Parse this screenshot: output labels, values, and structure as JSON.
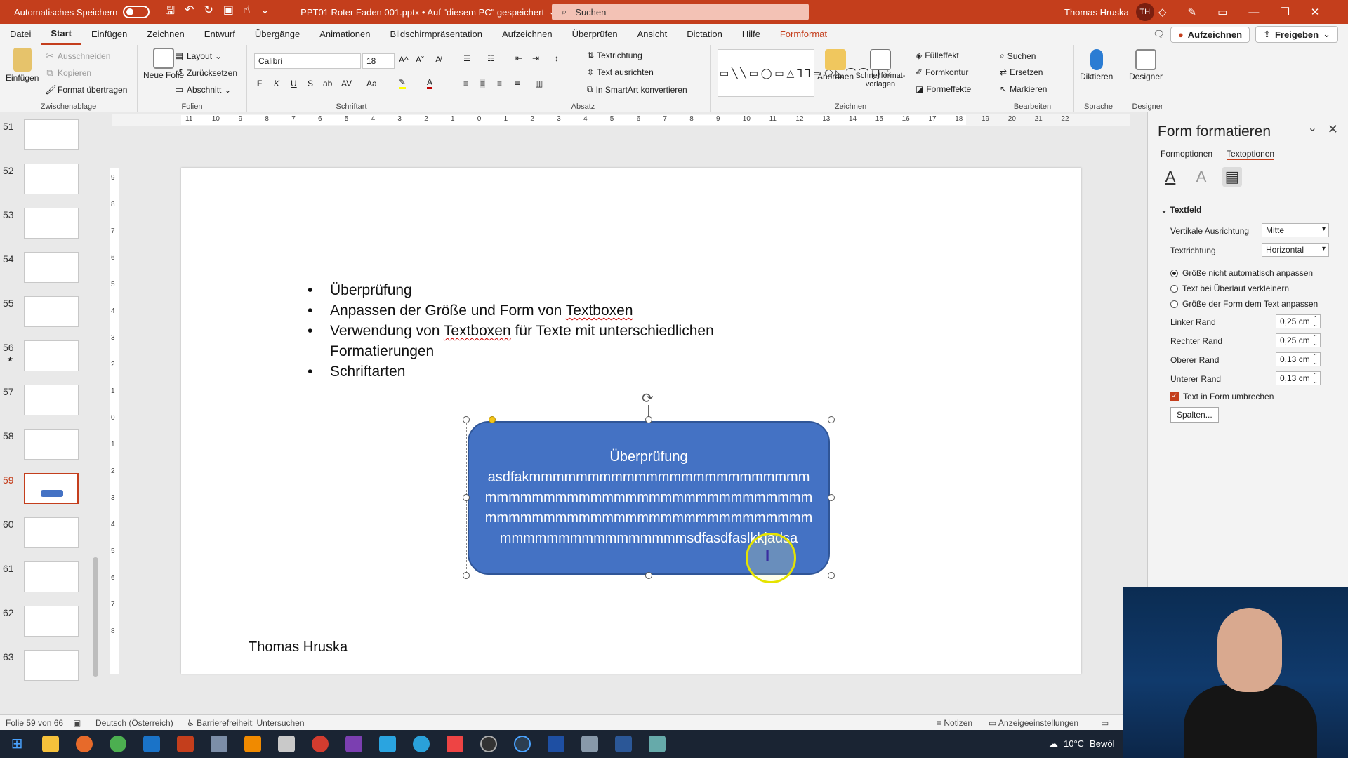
{
  "titlebar": {
    "autosave_label": "Automatisches Speichern",
    "doc_title": "PPT01 Roter Faden 001.pptx • Auf \"diesem PC\" gespeichert",
    "search_placeholder": "Suchen",
    "user_name": "Thomas Hruska",
    "user_initials": "TH"
  },
  "menu": {
    "tabs": [
      "Datei",
      "Start",
      "Einfügen",
      "Zeichnen",
      "Entwurf",
      "Übergänge",
      "Animationen",
      "Bildschirmpräsentation",
      "Aufzeichnen",
      "Überprüfen",
      "Ansicht",
      "Dictation",
      "Hilfe",
      "Formformat"
    ],
    "active_tab": "Start",
    "record_label": "Aufzeichnen",
    "share_label": "Freigeben"
  },
  "ribbon": {
    "clipboard": {
      "paste": "Einfügen",
      "cut": "Ausschneiden",
      "copy": "Kopieren",
      "format_painter": "Format übertragen",
      "label": "Zwischenablage"
    },
    "slides": {
      "new_slide": "Neue Folie",
      "layout": "Layout",
      "reset": "Zurücksetzen",
      "section": "Abschnitt",
      "label": "Folien"
    },
    "font": {
      "family": "Calibri",
      "size": "18",
      "bold": "F",
      "italic": "K",
      "underline": "U",
      "shadow": "S",
      "strike": "ab",
      "spacing": "AV",
      "case": "Aa",
      "label": "Schriftart"
    },
    "paragraph": {
      "text_direction": "Textrichtung",
      "align_text": "Text ausrichten",
      "smartart": "In SmartArt konvertieren",
      "label": "Absatz"
    },
    "drawing": {
      "arrange": "Anordnen",
      "quick_styles": "Schnellformat-vorlagen",
      "fill": "Fülleffekt",
      "outline": "Formkontur",
      "effects": "Formeffekte",
      "label": "Zeichnen"
    },
    "editing": {
      "find": "Suchen",
      "replace": "Ersetzen",
      "select": "Markieren",
      "label": "Bearbeiten"
    },
    "voice": {
      "dictate": "Diktieren",
      "label": "Sprache"
    },
    "designer": {
      "designer": "Designer",
      "label": "Designer"
    }
  },
  "thumbnails": [
    {
      "num": "51"
    },
    {
      "num": "52"
    },
    {
      "num": "53"
    },
    {
      "num": "54"
    },
    {
      "num": "55"
    },
    {
      "num": "56"
    },
    {
      "num": "57"
    },
    {
      "num": "58"
    },
    {
      "num": "59"
    },
    {
      "num": "60"
    },
    {
      "num": "61"
    },
    {
      "num": "62"
    },
    {
      "num": "63"
    }
  ],
  "active_slide": "59",
  "ruler": {
    "h_ticks": [
      "11",
      "10",
      "9",
      "8",
      "7",
      "6",
      "5",
      "4",
      "3",
      "2",
      "1",
      "0",
      "1",
      "2",
      "3",
      "4",
      "5",
      "6",
      "7",
      "8",
      "9",
      "10",
      "11",
      "12",
      "13",
      "14",
      "15",
      "16",
      "17",
      "18",
      "19",
      "20",
      "21",
      "22"
    ],
    "v_ticks": [
      "9",
      "8",
      "7",
      "6",
      "5",
      "4",
      "3",
      "2",
      "1",
      "0",
      "1",
      "2",
      "3",
      "4",
      "5",
      "6",
      "7",
      "8"
    ]
  },
  "slide": {
    "bullets": [
      "Überprüfung",
      "Anpassen der Größe und Form von Textboxen",
      "Verwendung von Textboxen für Texte mit unterschiedlichen Formatierungen",
      "Schriftarten"
    ],
    "shape_title": "Überprüfung",
    "shape_body": "asdfakmmmmmmmmmmmmmmmmmmmmmmmmmmmmmmmmmmmmmmmmmmmmmmmmmmmmmmmmmmmmmmmmmmmmmmmmmmmmmmmmmmmmmmmmmmmmmmmmsdfasdfaslkkjadsa",
    "footer_name": "Thomas Hruska"
  },
  "pane": {
    "title": "Form formatieren",
    "tabs": [
      "Formoptionen",
      "Textoptionen"
    ],
    "section": "Textfeld",
    "vertical_align_label": "Vertikale Ausrichtung",
    "vertical_align_value": "Mitte",
    "text_direction_label": "Textrichtung",
    "text_direction_value": "Horizontal",
    "radio_no_autofit": "Größe nicht automatisch anpassen",
    "radio_shrink": "Text bei Überlauf verkleinern",
    "radio_resize": "Größe der Form dem Text anpassen",
    "left_margin_label": "Linker Rand",
    "left_margin": "0,25 cm",
    "right_margin_label": "Rechter Rand",
    "right_margin": "0,25 cm",
    "top_margin_label": "Oberer Rand",
    "top_margin": "0,13 cm",
    "bottom_margin_label": "Unterer Rand",
    "bottom_margin": "0,13 cm",
    "wrap_label": "Text in Form umbrechen",
    "columns_button": "Spalten..."
  },
  "status": {
    "slide_counter": "Folie 59 von 66",
    "language": "Deutsch (Österreich)",
    "accessibility": "Barrierefreiheit: Untersuchen",
    "notes": "Notizen",
    "display_settings": "Anzeigeeinstellungen"
  },
  "taskbar": {
    "temperature": "10°C",
    "weather": "Bewöl"
  },
  "colors": {
    "accent": "#c43e1c",
    "shape_fill": "#4472c4"
  }
}
